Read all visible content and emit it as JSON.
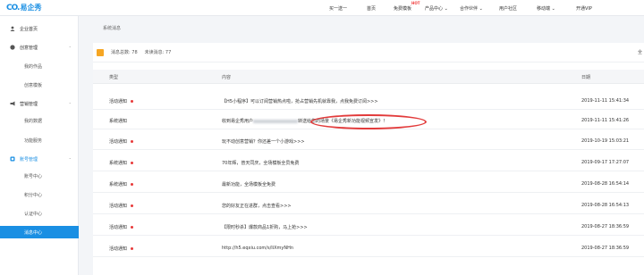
{
  "topbar": {
    "logo_mark": "CO.",
    "logo_text": "易企秀",
    "nav": [
      {
        "label": "买一送一"
      },
      {
        "label": "首页"
      },
      {
        "label": "免费模板"
      },
      {
        "label": "产品中心 ⌄"
      },
      {
        "label": "合作伙伴 ⌄"
      },
      {
        "label": "用户社区"
      },
      {
        "label": "移动端 ⌄"
      },
      {
        "label": "开通VIP"
      }
    ],
    "hot_badge": "HOT"
  },
  "sidebar": {
    "home": "企业首页",
    "groups": [
      {
        "label": "创意管理",
        "items": [
          "我的作品",
          "创意模板"
        ]
      },
      {
        "label": "营销管理",
        "items": [
          "我的数据",
          "功能服务"
        ]
      },
      {
        "label": "账号管理",
        "items": [
          "账号中心",
          "积分中心",
          "认证中心"
        ]
      }
    ],
    "active_item": "消息中心",
    "caret": "⌃"
  },
  "breadcrumb": "系统消息",
  "summary": {
    "total_label": "消息总数: 78",
    "unread_label": "未读消息: 77",
    "right_label": "全"
  },
  "table": {
    "headers": [
      "类型",
      "内容",
      "日期"
    ],
    "rows": [
      {
        "type": "活动通知",
        "unread": true,
        "content": "【H5小程序】可以订阅营销热点啦，抢占营销先机就靠我，点我免费订阅>>>",
        "date": "2019-11-11 15:41:34"
      },
      {
        "type": "系统通知",
        "unread": false,
        "content_prefix": "收到易企秀用户",
        "content_suffix": "转送给您的场景《易企秀新功能视频宣发》！",
        "date": "2019-11-11 15:41:26"
      },
      {
        "type": "活动通知",
        "unread": true,
        "content": "玩不动创意营销？你还差一个小游戏>>>",
        "date": "2019-10-19 15:03:21"
      },
      {
        "type": "系统通知",
        "unread": true,
        "content": "70年辉，普天同庆，全场模板全员免费",
        "date": "2019-09-17 17:27:07"
      },
      {
        "type": "系统通知",
        "unread": true,
        "content": "最新功能，全场模板全免费",
        "date": "2019-08-28 16:54:14"
      },
      {
        "type": "活动通知",
        "unread": true,
        "content": "您的好友正在进群，点击查看>>>",
        "date": "2019-08-28 16:54:13"
      },
      {
        "type": "活动通知",
        "unread": true,
        "content": "【限时秒杀】爆款商品1折购，马上抢>>>",
        "date": "2019-08-27 18:36:59"
      },
      {
        "type": "活动通知",
        "unread": true,
        "content": "http://h5.eqxiu.com/s/IiXmyNHn",
        "date": "2019-08-27 18:36:59"
      }
    ]
  }
}
